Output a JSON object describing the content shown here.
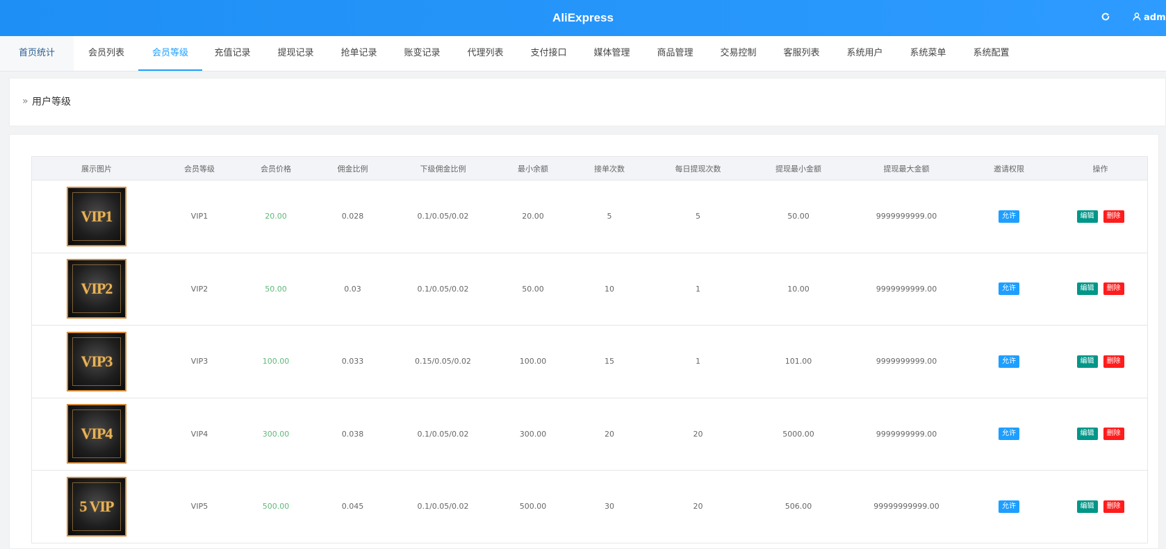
{
  "header": {
    "title": "AliExpress",
    "username": "admi"
  },
  "nav": {
    "tabs": [
      "首页统计",
      "会员列表",
      "会员等级",
      "充值记录",
      "提现记录",
      "抢单记录",
      "账变记录",
      "代理列表",
      "支付接口",
      "媒体管理",
      "商品管理",
      "交易控制",
      "客服列表",
      "系统用户",
      "系统菜单",
      "系统配置"
    ],
    "active_index": 2
  },
  "breadcrumb": {
    "arrow": "»",
    "label": "用户等级"
  },
  "table": {
    "columns": [
      "展示图片",
      "会员等级",
      "会员价格",
      "佣金比例",
      "下级佣金比例",
      "最小余额",
      "接单次数",
      "每日提现次数",
      "提现最小金额",
      "提现最大金额",
      "邀请权限",
      "操作"
    ],
    "rows": [
      {
        "image_text": "VIP1",
        "level": "VIP1",
        "price": "20.00",
        "commission": "0.028",
        "sub_commission": "0.1/0.05/0.02",
        "min_balance": "20.00",
        "orders": "5",
        "daily_withdraw": "5",
        "withdraw_min": "50.00",
        "withdraw_max": "9999999999.00",
        "invite": "允许"
      },
      {
        "image_text": "VIP2",
        "level": "VIP2",
        "price": "50.00",
        "commission": "0.03",
        "sub_commission": "0.1/0.05/0.02",
        "min_balance": "50.00",
        "orders": "10",
        "daily_withdraw": "1",
        "withdraw_min": "10.00",
        "withdraw_max": "9999999999.00",
        "invite": "允许"
      },
      {
        "image_text": "VIP3",
        "level": "VIP3",
        "price": "100.00",
        "commission": "0.033",
        "sub_commission": "0.15/0.05/0.02",
        "min_balance": "100.00",
        "orders": "15",
        "daily_withdraw": "1",
        "withdraw_min": "101.00",
        "withdraw_max": "9999999999.00",
        "invite": "允许"
      },
      {
        "image_text": "VIP4",
        "level": "VIP4",
        "price": "300.00",
        "commission": "0.038",
        "sub_commission": "0.1/0.05/0.02",
        "min_balance": "300.00",
        "orders": "20",
        "daily_withdraw": "20",
        "withdraw_min": "5000.00",
        "withdraw_max": "9999999999.00",
        "invite": "允许"
      },
      {
        "image_text": "5 VIP",
        "level": "VIP5",
        "price": "500.00",
        "commission": "0.045",
        "sub_commission": "0.1/0.05/0.02",
        "min_balance": "500.00",
        "orders": "30",
        "daily_withdraw": "20",
        "withdraw_min": "506.00",
        "withdraw_max": "99999999999.00",
        "invite": "允许"
      }
    ],
    "edit_label": "编辑",
    "delete_label": "删除"
  },
  "colors": {
    "header_bg": "#1e8ff5",
    "accent": "#1e9fff",
    "price_green": "#5fb878",
    "edit_teal": "#009688",
    "delete_red": "#ff1c1c",
    "vip_gold": "#e7b45a"
  },
  "icons": {
    "refresh": "refresh-icon",
    "user": "user-icon",
    "breadcrumb": "double-chevron-right-icon"
  }
}
